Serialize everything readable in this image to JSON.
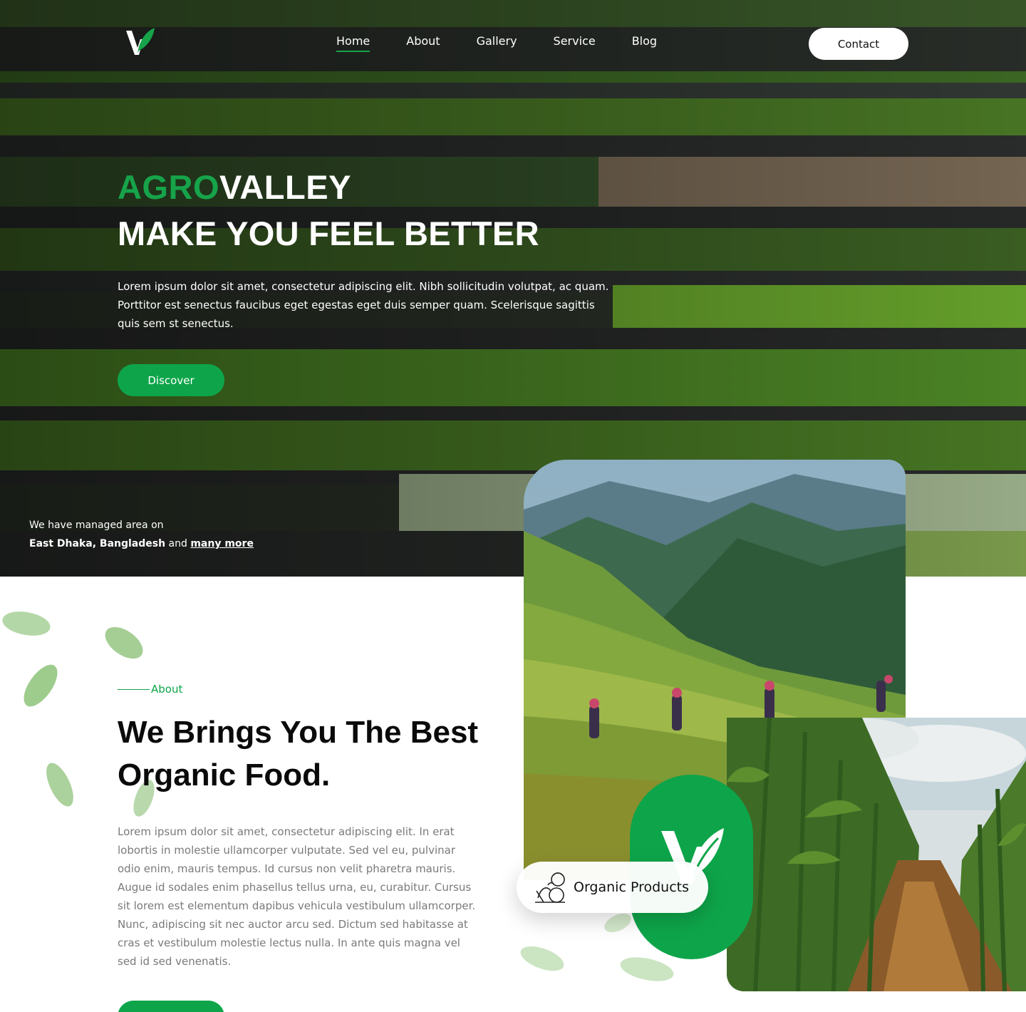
{
  "brand": {
    "accent": "#0ea54a",
    "dark_green": "#1d2a1c"
  },
  "nav": {
    "items": [
      {
        "label": "Home",
        "active": true
      },
      {
        "label": "About",
        "active": false
      },
      {
        "label": "Gallery",
        "active": false
      },
      {
        "label": "Service",
        "active": false
      },
      {
        "label": "Blog",
        "active": false
      }
    ],
    "contact_label": "Contact"
  },
  "hero": {
    "title_accent": "AGRO",
    "title_rest": "VALLEY",
    "subtitle": "MAKE YOU FEEL BETTER",
    "text": "Lorem ipsum dolor sit amet, consectetur adipiscing elit. Nibh sollicitudin volutpat, ac quam. Porttitor est senectus faucibus eget egestas eget duis semper quam. Scelerisque sagittis quis sem st senectus.",
    "button_label": "Discover",
    "managed_intro": "We have managed area on",
    "managed_location": "East Dhaka, Bangladesh",
    "managed_and": "and",
    "managed_more": "many more"
  },
  "about": {
    "eyebrow": "About",
    "title": "We Brings You The Best Organic Food.",
    "text": "Lorem ipsum dolor sit amet, consectetur adipiscing elit. In erat lobortis in molestie ullamcorper vulputate. Sed vel eu, pulvinar odio enim, mauris tempus. Id cursus non velit pharetra mauris. Augue id sodales enim phasellus tellus urna, eu, curabitur. Cursus sit lorem est elementum dapibus vehicula vestibulum ullamcorper. Nunc, adipiscing sit nec auctor arcu sed. Dictum sed habitasse at cras et vestibulum molestie lectus nulla. In ante quis magna vel sed id sed venenatis.",
    "badge_label": "Organic Products",
    "badge_icon": "vegetables-icon"
  },
  "icons": {
    "logo": "leaf-v-logo"
  }
}
